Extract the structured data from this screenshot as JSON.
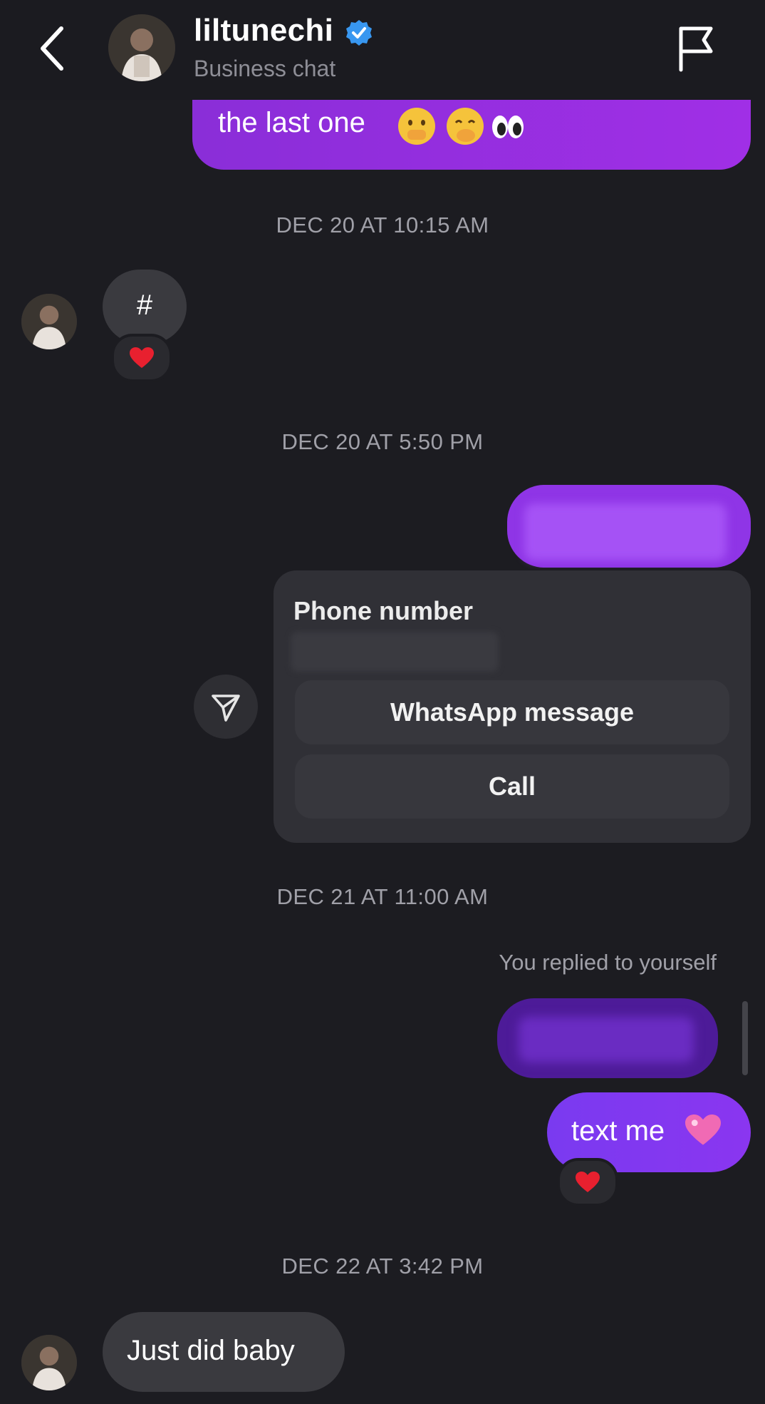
{
  "header": {
    "username": "liltunechi",
    "subtitle": "Business chat",
    "back_icon": "chevron-left-icon",
    "verified_icon": "verified-badge-icon",
    "report_icon": "flag-icon"
  },
  "messages": {
    "top_bubble_text": "the last one",
    "timestamp_1": "DEC 20 AT 10:15 AM",
    "hash_text": "#",
    "timestamp_2": "DEC 20 AT 5:50 PM",
    "contact_card": {
      "title": "Phone number",
      "whatsapp_label": "WhatsApp message",
      "call_label": "Call"
    },
    "timestamp_3": "DEC 21 AT 11:00 AM",
    "replied_note": "You replied to yourself",
    "text_me": "text me",
    "timestamp_4": "DEC 22 AT 3:42 PM",
    "just_did": "Just did baby"
  },
  "colors": {
    "outgoing_bubble": "#9a2fe2",
    "incoming_bubble": "#3a3a3f",
    "background": "#1c1c21",
    "verified_blue": "#3897f0",
    "reaction_heart": "#e8202f"
  }
}
